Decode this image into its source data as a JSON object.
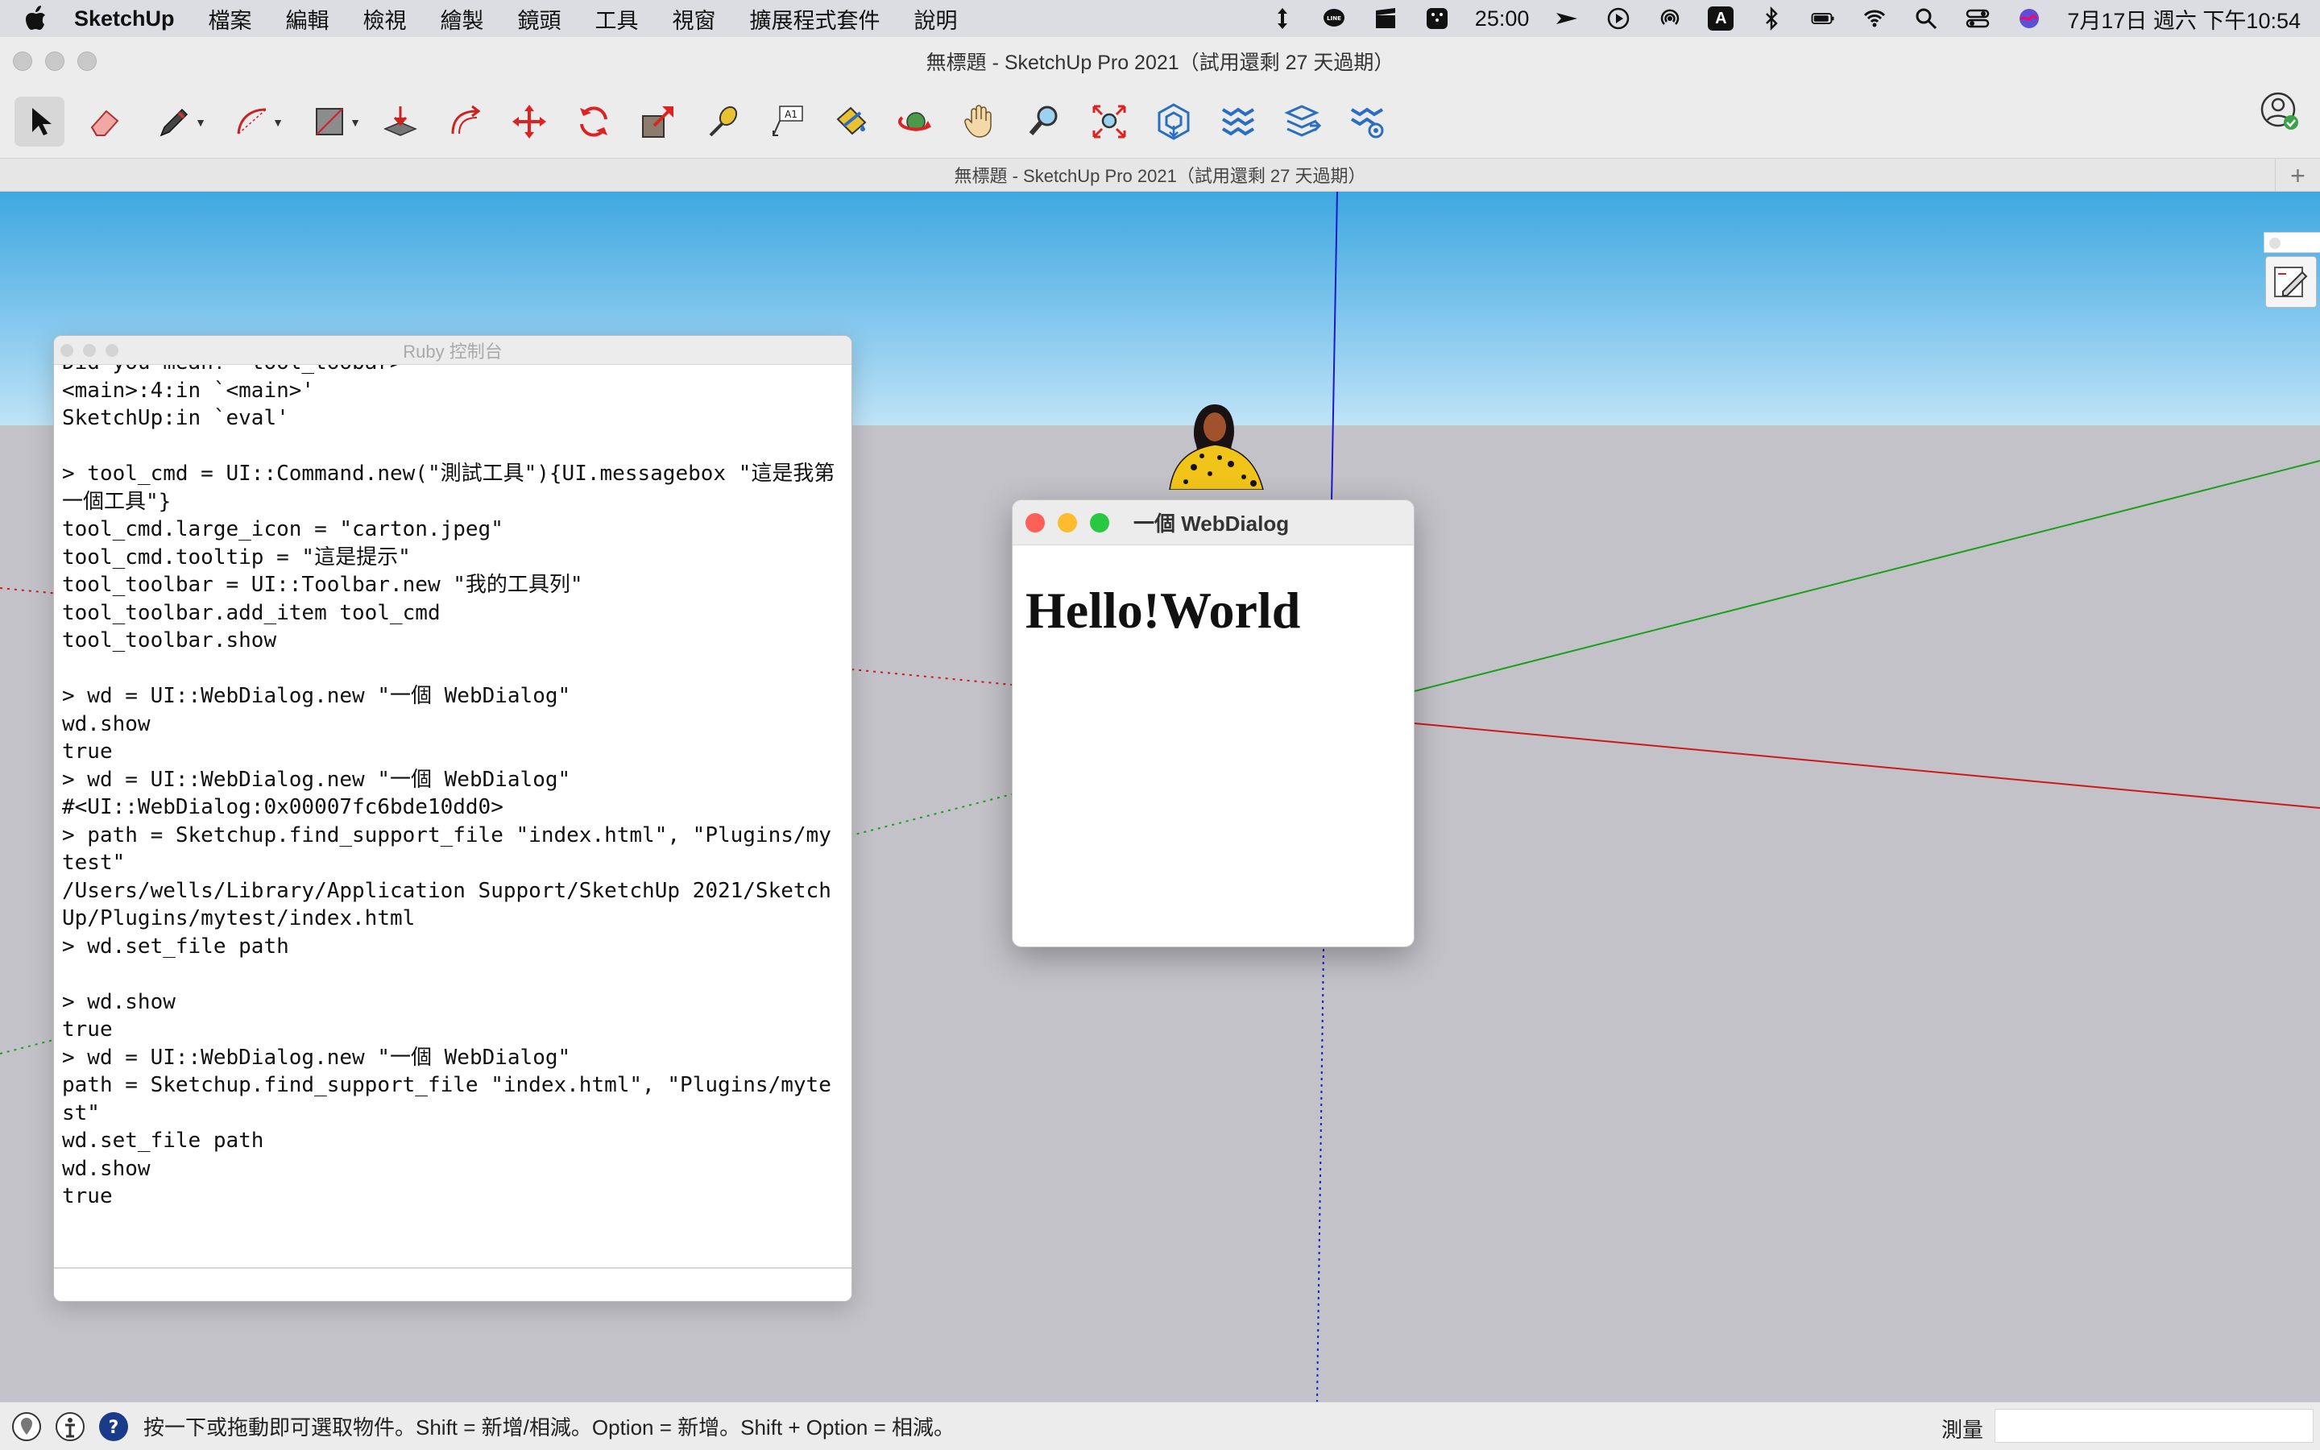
{
  "menubar": {
    "app_name": "SketchUp",
    "items": [
      "檔案",
      "編輯",
      "檢視",
      "繪製",
      "鏡頭",
      "工具",
      "視窗",
      "擴展程式套件",
      "說明"
    ],
    "status": {
      "timer": "25:00",
      "input_source": "A",
      "datetime": "7月17日 週六 下午10:54"
    }
  },
  "window": {
    "title": "無標題 - SketchUp Pro 2021（試用還剩 27 天過期）",
    "tab_title": "無標題 - SketchUp Pro 2021（試用還剩 27 天過期）",
    "tab_add": "+"
  },
  "toolbar": {
    "tools": [
      "select-tool",
      "eraser-tool",
      "pencil-tool",
      "arc-tool",
      "rectangle-tool",
      "push-pull-tool",
      "offset-tool",
      "move-tool",
      "rotate-tool",
      "scale-tool",
      "tape-measure-tool",
      "text-tool",
      "paint-bucket-tool",
      "orbit-tool",
      "pan-tool",
      "zoom-tool",
      "zoom-extents-tool",
      "warehouse-tool",
      "extension-warehouse-tool",
      "layout-tool",
      "extension-manager-tool"
    ]
  },
  "ruby_console": {
    "title": "Ruby 控制台",
    "lines": [
      "Did you mean?  tool_toobar>",
      "<main>:4:in `<main>'",
      "SketchUp:in `eval'",
      "",
      "> tool_cmd = UI::Command.new(\"測試工具\"){UI.messagebox \"這是我第一個工具\"}",
      "tool_cmd.large_icon = \"carton.jpeg\"",
      "tool_cmd.tooltip = \"這是提示\"",
      "tool_toolbar = UI::Toolbar.new \"我的工具列\"",
      "tool_toolbar.add_item tool_cmd",
      "tool_toolbar.show",
      "",
      "> wd = UI::WebDialog.new \"一個 WebDialog\"",
      "wd.show",
      "true",
      "> wd = UI::WebDialog.new \"一個 WebDialog\"",
      "#<UI::WebDialog:0x00007fc6bde10dd0>",
      "> path = Sketchup.find_support_file \"index.html\", \"Plugins/mytest\"",
      "/Users/wells/Library/Application Support/SketchUp 2021/SketchUp/Plugins/mytest/index.html",
      "> wd.set_file path",
      "",
      "> wd.show",
      "true",
      "> wd = UI::WebDialog.new \"一個 WebDialog\"",
      "path = Sketchup.find_support_file \"index.html\", \"Plugins/mytest\"",
      "wd.set_file path",
      "wd.show",
      "true"
    ]
  },
  "webdialog": {
    "title": "一個 WebDialog",
    "heading": "Hello!World"
  },
  "statusbar": {
    "hint": "按一下或拖動即可選取物件。Shift = 新增/相減。Option = 新增。Shift + Option = 相減。",
    "measure_label": "測量",
    "measure_value": ""
  },
  "colors": {
    "sky_top": "#3fa8e0",
    "ground": "#c3c2c8",
    "red_axis": "#cc1a1a",
    "green_axis": "#1aa01a",
    "blue_axis": "#1a1acc",
    "traffic_red": "#fe5f57",
    "traffic_yellow": "#febc2e",
    "traffic_green": "#28c840"
  }
}
